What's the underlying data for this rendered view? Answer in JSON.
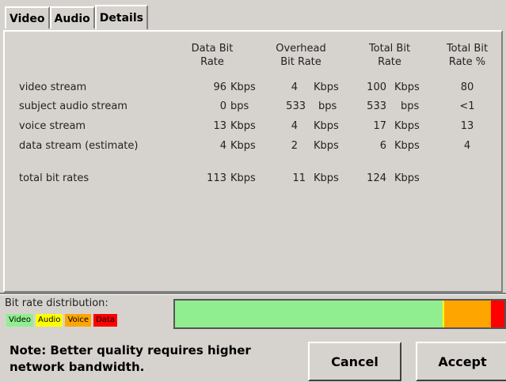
{
  "tabs": [
    "Video",
    "Audio",
    "Details"
  ],
  "columns": {
    "data_bit_rate": [
      "Data Bit",
      "Rate"
    ],
    "overhead_bit_rate": [
      "Overhead",
      "Bit Rate"
    ],
    "total_bit_rate": [
      "Total Bit",
      "Rate"
    ],
    "total_bit_rate_pct": [
      "Total Bit",
      "Rate %"
    ]
  },
  "rows": [
    {
      "label": "video stream",
      "data": "96",
      "data_unit": "Kbps",
      "overhead": "4",
      "overhead_unit": "Kbps",
      "total": "100",
      "total_unit": "Kbps",
      "pct": "80"
    },
    {
      "label": "subject audio stream",
      "data": "0",
      "data_unit": "bps",
      "overhead": "533",
      "overhead_unit": "bps",
      "total": "533",
      "total_unit": "bps",
      "pct": "<1"
    },
    {
      "label": "voice stream",
      "data": "13",
      "data_unit": "Kbps",
      "overhead": "4",
      "overhead_unit": "Kbps",
      "total": "17",
      "total_unit": "Kbps",
      "pct": "13"
    },
    {
      "label": "data stream (estimate)",
      "data": "4",
      "data_unit": "Kbps",
      "overhead": "2",
      "overhead_unit": "Kbps",
      "total": "6",
      "total_unit": "Kbps",
      "pct": "4"
    }
  ],
  "totals": {
    "label": "total bit rates",
    "data": "113",
    "data_unit": "Kbps",
    "overhead": "11",
    "overhead_unit": "Kbps",
    "total": "124",
    "total_unit": "Kbps"
  },
  "distribution": {
    "label": "Bit rate distribution:",
    "legend": [
      {
        "name": "Video",
        "color": "#90ee90"
      },
      {
        "name": "Audio",
        "color": "#ffff00"
      },
      {
        "name": "Voice",
        "color": "#ffa500"
      },
      {
        "name": "Data",
        "color": "#ff0000"
      }
    ],
    "segments_pct": [
      80,
      0.4,
      14,
      4
    ]
  },
  "note": "Note: Better quality requires higher network bandwidth.",
  "buttons": {
    "cancel": "Cancel",
    "accept": "Accept"
  }
}
